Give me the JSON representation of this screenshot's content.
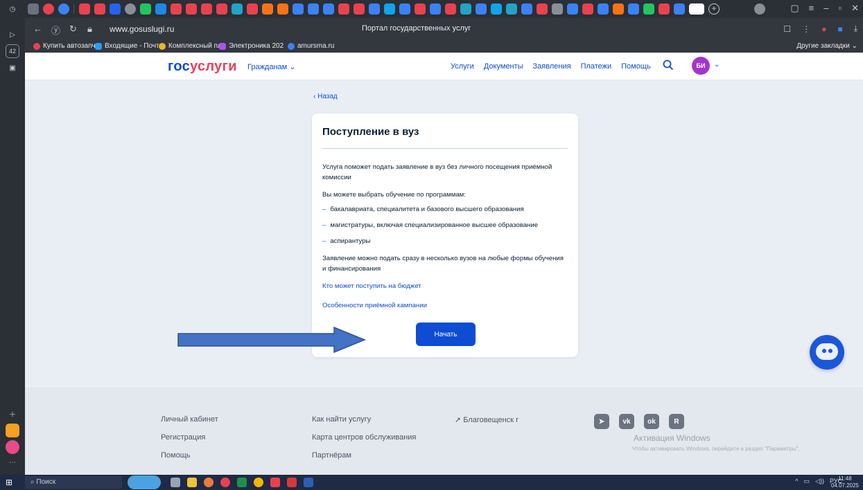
{
  "browser": {
    "tab_counter": "42",
    "url": "www.gosuslugi.ru",
    "page_title": "Портал государственных услуг",
    "bookmarks": [
      "Купить автозапч",
      "Входящие - Почта",
      "Комплексный пла",
      "Электроника 202",
      "amursma.ru"
    ],
    "other_bookmarks": "Другие закладки"
  },
  "header": {
    "logo_part1": "гос",
    "logo_part2": "услуги",
    "citizens": "Гражданам",
    "nav": [
      "Услуги",
      "Документы",
      "Заявления",
      "Платежи",
      "Помощь"
    ],
    "avatar_initials": "БИ"
  },
  "main": {
    "back": "Назад",
    "title": "Поступление в вуз",
    "intro": "Услуга поможет подать заявление в вуз без личного посещения приёмной комиссии",
    "programs_heading": "Вы можете выбрать обучение по программам:",
    "programs": [
      "бакалавриата, специалитета и базового высшего образования",
      "магистратуры, включая специализированное высшее образование",
      "аспирантуры"
    ],
    "note": "Заявление можно подать сразу в несколько вузов на любые формы обучения и финансирования",
    "link_budget": "Кто может поступить на бюджет",
    "link_campaign": "Особенности приёмной кампании",
    "start_button": "Начать"
  },
  "footer": {
    "col1": [
      "Личный кабинет",
      "Регистрация",
      "Помощь"
    ],
    "col2": [
      "Как найти услугу",
      "Карта центров обслуживания",
      "Партнёрам"
    ],
    "city": "Благовещенск г",
    "windows_activation": "Активация Windows",
    "windows_activation_sub": "Чтобы активировать Windows, перейдите в раздел \"Параметры\"."
  },
  "taskbar": {
    "search": "Поиск",
    "lang": "РУС",
    "time": "11:48",
    "date": "04.07.2025"
  }
}
